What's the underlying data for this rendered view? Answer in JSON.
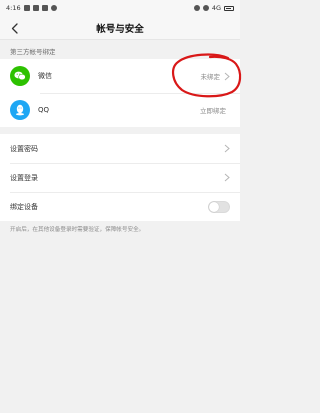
{
  "status_bar": {
    "time": "4:16",
    "signal": "4G",
    "battery": "20"
  },
  "nav": {
    "title": "帐号与安全"
  },
  "third_party": {
    "section_title": "第三方帐号绑定",
    "items": [
      {
        "icon": "wechat-icon",
        "label": "微信",
        "value": "未绑定",
        "color": "#2dc100"
      },
      {
        "icon": "qq-icon",
        "label": "QQ",
        "value": "立即绑定",
        "color": "#1ea7f4"
      }
    ]
  },
  "settings": {
    "items": [
      {
        "label": "设置密码"
      },
      {
        "label": "设置登录"
      },
      {
        "label": "绑定设备",
        "toggle_on": false
      }
    ]
  },
  "footnote": "开启后，在其他设备登录时需要验证，保障帐号安全。",
  "annotation": {
    "color": "#d91818"
  }
}
